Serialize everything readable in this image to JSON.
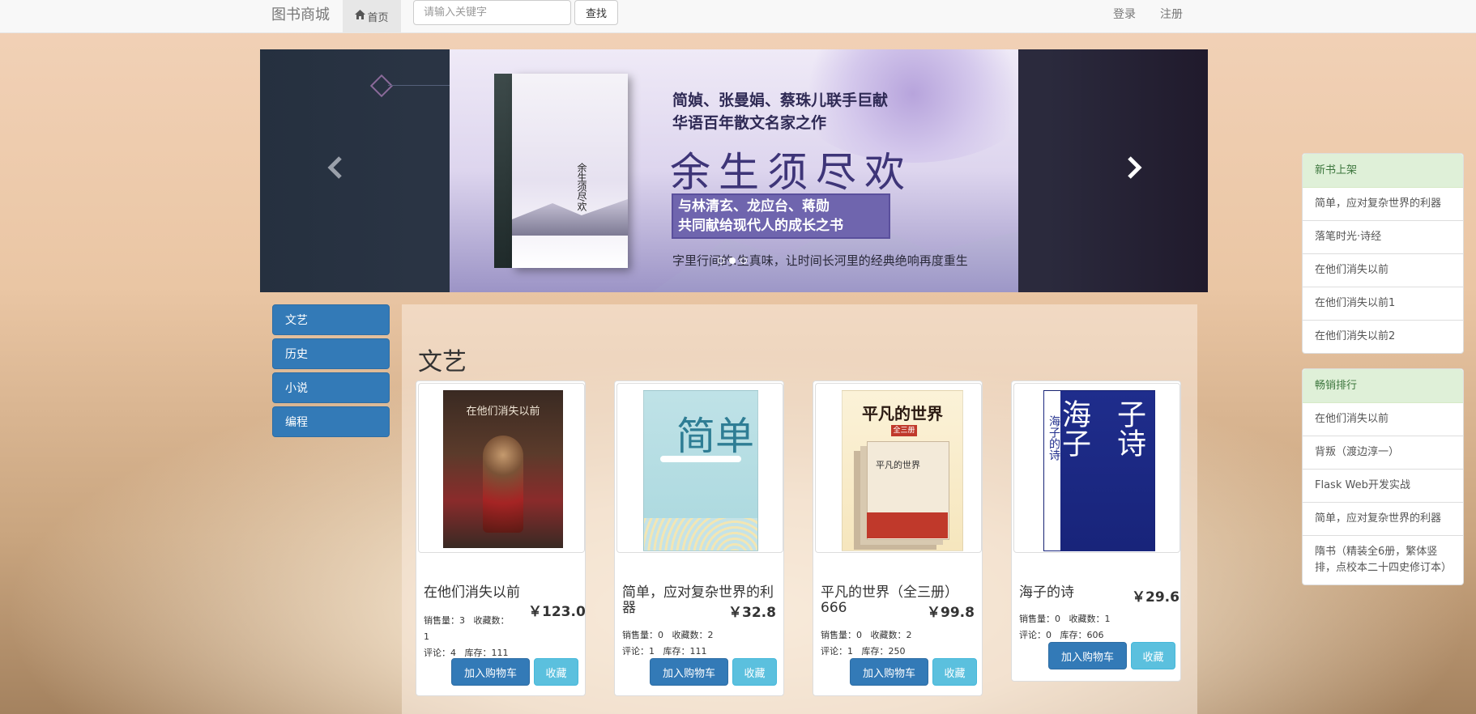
{
  "navbar": {
    "brand": "图书商城",
    "home": "首页",
    "search_placeholder": "请输入关键字",
    "search_button": "查找",
    "login": "登录",
    "register": "注册"
  },
  "carousel": {
    "line1": "简媜、张曼娟、蔡珠儿联手巨献",
    "line2": "华语百年散文名家之作",
    "main_title": "余生须尽欢",
    "box_line1": "与林清玄、龙应台、蒋勋",
    "box_line2": "共同献给现代人的成长之书",
    "footer": "字里行间的.生真味，让时间长河里的经典绝响再度重生",
    "book_cover_title": "余生须尽欢",
    "active_slide": 1,
    "slide_count": 3
  },
  "categories": [
    "文艺",
    "历史",
    "小说",
    "编程"
  ],
  "section_title": "文艺",
  "books": [
    {
      "title": "在他们消失以前",
      "price": "￥123.0",
      "sales": "销售量：3",
      "favorites": "收藏数：1",
      "comments": "评论：4",
      "stock": "库存：111",
      "cart_label": "加入购物车",
      "fav_label": "收藏",
      "cover_text": "在他们消失以前"
    },
    {
      "title": "简单，应对复杂世界的利器",
      "price": "￥32.8",
      "sales": "销售量：0",
      "favorites": "收藏数：2",
      "comments": "评论：1",
      "stock": "库存：111",
      "cart_label": "加入购物车",
      "fav_label": "收藏",
      "cover_text": "简单"
    },
    {
      "title": "平凡的世界（全三册）666",
      "price": "￥99.8",
      "sales": "销售量：0",
      "favorites": "收藏数：2",
      "comments": "评论：1",
      "stock": "库存：250",
      "cart_label": "加入购物车",
      "fav_label": "收藏",
      "cover_text": "平凡的世界",
      "cover_tag": "全三册",
      "cover_box": "平凡的世界"
    },
    {
      "title": "海子的诗",
      "price": "￥29.6",
      "sales": "销售量：0",
      "favorites": "收藏数：1",
      "comments": "评论：0",
      "stock": "库存：606",
      "cart_label": "加入购物车",
      "fav_label": "收藏",
      "cover_text_1": "海子",
      "cover_text_2": "子诗",
      "cover_strip": "海子的诗"
    }
  ],
  "new_books": {
    "heading": "新书上架",
    "items": [
      "简单，应对复杂世界的利器",
      "落笔时光·诗经",
      "在他们消失以前",
      "在他们消失以前1",
      "在他们消失以前2"
    ]
  },
  "bestsellers": {
    "heading": "畅销排行",
    "items": [
      "在他们消失以前",
      "背叛（渡边淳一）",
      "Flask Web开发实战",
      "简单，应对复杂世界的利器",
      "隋书（精装全6册，繁体竖排，点校本二十四史修订本）"
    ]
  },
  "icons": {
    "home": "home-icon",
    "prev": "chevron-left-icon",
    "next": "chevron-right-icon"
  },
  "colors": {
    "primary": "#337ab7",
    "info": "#5bc0de",
    "panel_head": "#dff0d8"
  }
}
